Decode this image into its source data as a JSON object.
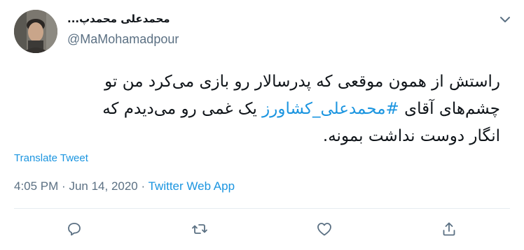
{
  "tweet": {
    "display_name": "محمدعلی محمدپ...",
    "handle": "@MaMohamadpour",
    "text_parts": {
      "line1": "راستش از همون موقعی که پدرسالار رو بازی می‌کرد من تو",
      "pre_hashtag": "چشم‌های آقای ",
      "hashtag": "#محمدعلی_کشاورز",
      "post_hashtag": " یک غمی رو می‌دیدم که",
      "line3": "انگار دوست نداشت بمونه."
    },
    "translate_label": "Translate Tweet",
    "time": "4:05 PM",
    "separator": "·",
    "date": "Jun 14, 2020",
    "source": "Twitter Web App"
  },
  "icons": {
    "more": "chevron-down-icon",
    "reply": "reply-icon",
    "retweet": "retweet-icon",
    "like": "like-icon",
    "share": "share-icon"
  },
  "colors": {
    "link": "#1b95e0",
    "muted": "#5b7083",
    "text": "#0f1419",
    "divider": "#e6ecf0"
  }
}
